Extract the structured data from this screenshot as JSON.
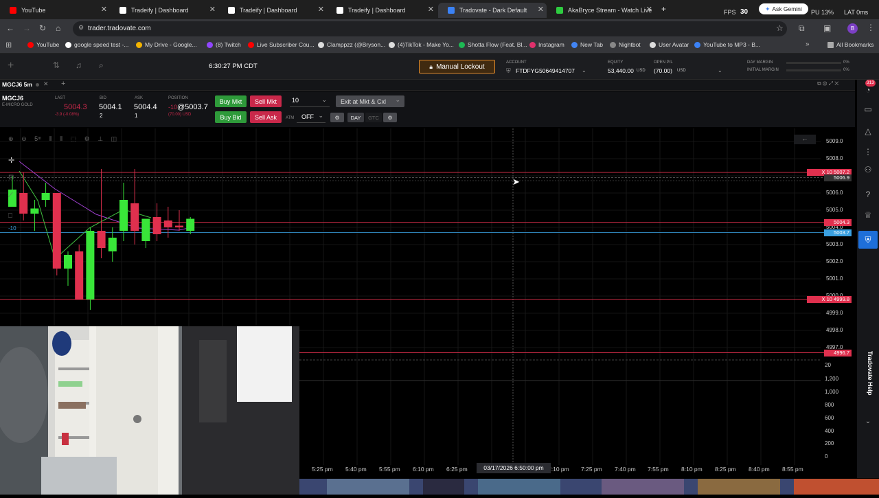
{
  "browser": {
    "tabs": [
      {
        "label": "YouTube",
        "color": "#ff0000"
      },
      {
        "label": "Tradeify | Dashboard",
        "color": "#ffffff"
      },
      {
        "label": "Tradeify | Dashboard",
        "color": "#ffffff"
      },
      {
        "label": "Tradeify | Dashboard",
        "color": "#ffffff"
      },
      {
        "label": "Tradovate - Dark Default",
        "color": "#3b82f6"
      },
      {
        "label": "AkaBryce Stream - Watch Live",
        "color": "#2ecc40"
      }
    ],
    "fps_label": "FPS",
    "fps_value": "30",
    "gemini": "Ask Gemini",
    "cpu": "PU 13%",
    "lat": "LAT 0ms",
    "url": "trader.tradovate.com",
    "profile": "B",
    "bookmarks": [
      {
        "label": "YouTube",
        "color": "#ff0000"
      },
      {
        "label": "google speed test -...",
        "color": "#ffffff"
      },
      {
        "label": "My Drive - Google...",
        "color": "#f4b400"
      },
      {
        "label": "(8) Twitch",
        "color": "#9146ff"
      },
      {
        "label": "Live Subscriber Cou...",
        "color": "#ff0000"
      },
      {
        "label": "Clamppzz (@Bryson...",
        "color": "#dddddd"
      },
      {
        "label": "(4)TikTok - Make Yo...",
        "color": "#dddddd"
      },
      {
        "label": "Shotta Flow (Feat. Bl...",
        "color": "#1db954"
      },
      {
        "label": "Instagram",
        "color": "#e1306c"
      },
      {
        "label": "New Tab",
        "color": "#4285f4"
      },
      {
        "label": "Nightbot",
        "color": "#888888"
      },
      {
        "label": "User Avatar",
        "color": "#dddddd"
      },
      {
        "label": "YouTube to MP3 - B...",
        "color": "#3b82f6"
      }
    ],
    "all_bookmarks": "All Bookmarks"
  },
  "app": {
    "time": "6:30:27 PM CDT",
    "lockout": "Manual Lockout",
    "account_label": "ACCOUNT",
    "account": "FTDFYG50649414707",
    "equity_label": "EQUITY",
    "equity": "53,440.00",
    "equity_unit": "USD",
    "openpl_label": "OPEN P/L",
    "openpl": "(70.00)",
    "openpl_unit": "USD",
    "day_margin_label": "DAY MARGIN",
    "initial_margin_label": "INITIAL MARGIN",
    "day_margin": "0%",
    "initial_margin": "0%",
    "chart_tab": "MGCJ6 5m",
    "notif_count": "313"
  },
  "order": {
    "symbol": "MGCJ6",
    "symbol_desc": "E-MICRO GOLD",
    "last_label": "LAST",
    "last": "5004.3",
    "last_change": "-3.9 (-0.08%)",
    "bid_label": "BID",
    "bid": "5004.1",
    "bid_size": "2",
    "ask_label": "ASK",
    "ask": "5004.4",
    "ask_size": "1",
    "position_label": "POSITION",
    "position_qty": "-10",
    "position_price": "@5003.7",
    "position_pl": "(70.00) USD",
    "buy_mkt": "Buy Mkt",
    "sell_mkt": "Sell Mkt",
    "buy_bid": "Buy Bid",
    "sell_ask": "Sell Ask",
    "qty": "10",
    "exit": "Exit at Mkt & Cxl",
    "atm_label": "ATM",
    "atm": "OFF",
    "day": "DAY",
    "gtc": "GTC"
  },
  "chart_data": {
    "type": "candlestick",
    "price_ticks": [
      "5009.0",
      "5008.0",
      "5007.0",
      "5006.0",
      "5005.0",
      "5004.0",
      "5003.0",
      "5002.0",
      "5001.0",
      "5000.0",
      "4999.0",
      "4998.0",
      "4997.0"
    ],
    "time_ticks": [
      "5:25 pm",
      "5:40 pm",
      "5:55 pm",
      "6:10 pm",
      "6:25 pm",
      "7:10 pm",
      "7:25 pm",
      "7:40 pm",
      "7:55 pm",
      "8:10 pm",
      "8:25 pm",
      "8:40 pm",
      "8:55 pm"
    ],
    "crosshair_time": "03/17/2026 6:50:00 pm",
    "volume_ticks": [
      "20",
      "1,200",
      "1,000",
      "800",
      "600",
      "400",
      "200",
      "0"
    ],
    "order_lines": [
      {
        "price": "5007.2",
        "qty": "10",
        "label": "X 10 5007.2",
        "color": "#e0304e"
      },
      {
        "price": "5006.9",
        "label": "5006.9",
        "color": "#555555"
      },
      {
        "price": "5004.3",
        "label": "5004.3",
        "color": "#e0304e"
      },
      {
        "price": "5003.7",
        "label": "5003.7",
        "color": "#3aa0e0"
      },
      {
        "price": "4999.8",
        "qty": "10",
        "label": "X 10 4999.8",
        "color": "#e0304e"
      },
      {
        "price": "4996.7",
        "label": "4996.7",
        "color": "#e0304e"
      }
    ],
    "position_marker": "-10",
    "candles": [
      {
        "o": 5006.2,
        "h": 5007.0,
        "l": 5005.6,
        "c": 5005.2,
        "up": true
      },
      {
        "o": 5006.0,
        "h": 5007.2,
        "l": 5004.4,
        "c": 5004.8,
        "up": false
      },
      {
        "o": 5004.8,
        "h": 5005.6,
        "l": 5003.8,
        "c": 5005.1,
        "up": true
      },
      {
        "o": 5005.6,
        "h": 5006.6,
        "l": 5005.2,
        "c": 5006.0,
        "up": true
      },
      {
        "o": 5006.0,
        "h": 5006.0,
        "l": 5001.2,
        "c": 5001.6,
        "up": false
      },
      {
        "o": 5001.6,
        "h": 5002.6,
        "l": 5000.6,
        "c": 5002.4,
        "up": true
      },
      {
        "o": 5002.6,
        "h": 5003.0,
        "l": 5000.2,
        "c": 4999.8,
        "up": false
      },
      {
        "o": 4999.8,
        "h": 5004.0,
        "l": 4999.2,
        "c": 5003.8,
        "up": true
      },
      {
        "o": 5003.8,
        "h": 5007.4,
        "l": 5002.2,
        "c": 5002.8,
        "up": false
      },
      {
        "o": 5002.6,
        "h": 5004.0,
        "l": 5002.0,
        "c": 5003.4,
        "up": true
      },
      {
        "o": 5003.8,
        "h": 5006.6,
        "l": 5003.2,
        "c": 5005.6,
        "up": true
      },
      {
        "o": 5005.4,
        "h": 5007.4,
        "l": 5003.0,
        "c": 5003.8,
        "up": false
      },
      {
        "o": 5003.2,
        "h": 5004.2,
        "l": 5002.8,
        "c": 5004.5,
        "up": true
      },
      {
        "o": 5004.6,
        "h": 5005.4,
        "l": 5003.2,
        "c": 5003.6,
        "up": false
      },
      {
        "o": 5004.4,
        "h": 5005.2,
        "l": 5003.4,
        "c": 5004.0,
        "up": false
      },
      {
        "o": 5004.0,
        "h": 5005.0,
        "l": 5003.8,
        "c": 5004.1,
        "up": false
      },
      {
        "o": 5003.8,
        "h": 5004.6,
        "l": 5003.6,
        "c": 5004.5,
        "up": true
      }
    ]
  }
}
